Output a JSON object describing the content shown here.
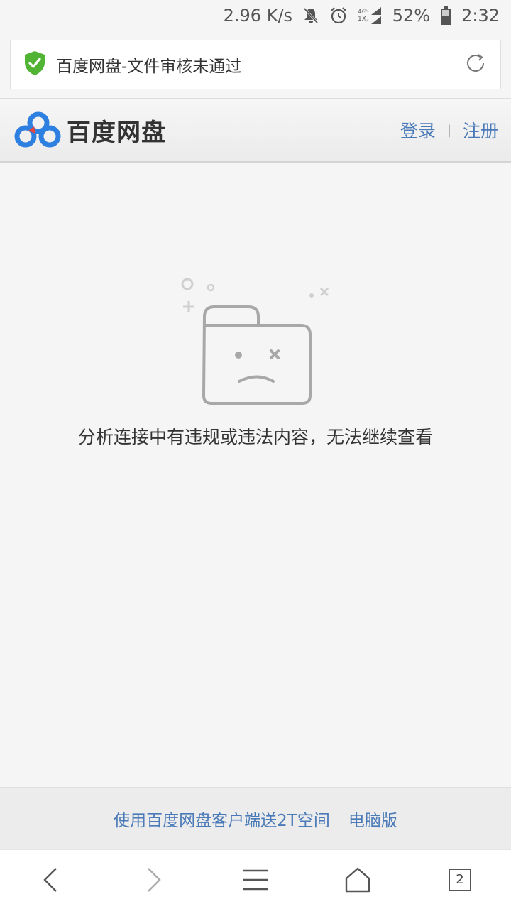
{
  "status_bar": {
    "speed": "2.96 K/s",
    "net_4g": "4G",
    "net_1x": "1X",
    "battery": "52%",
    "time": "2:32"
  },
  "address_bar": {
    "title": "百度网盘-文件审核未通过"
  },
  "header": {
    "logo_text": "百度网盘",
    "login": "登录",
    "separator": "|",
    "register": "注册"
  },
  "main": {
    "message": "分析连接中有违规或违法内容，无法继续查看"
  },
  "promo": {
    "client_link": "使用百度网盘客户端送2T空间",
    "pc_link": "电脑版"
  },
  "bottom_nav": {
    "tabs_count": "2"
  },
  "colors": {
    "link_blue": "#4a7ab8",
    "shield_green": "#52b435",
    "logo_blue": "#2d7fe0",
    "logo_red": "#e8453c"
  }
}
